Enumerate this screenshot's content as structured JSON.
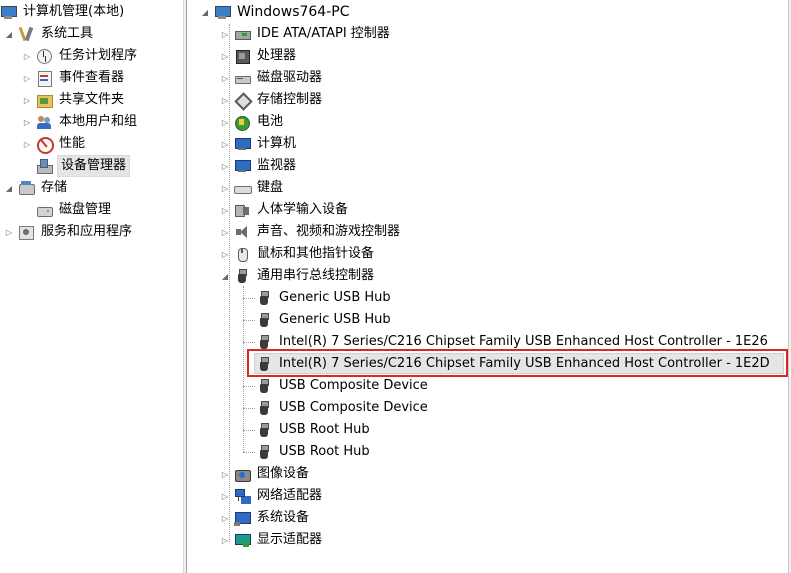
{
  "left_tree": {
    "root": "计算机管理(本地)",
    "system_tools": "系统工具",
    "task_scheduler": "任务计划程序",
    "event_viewer": "事件查看器",
    "shared_folders": "共享文件夹",
    "local_users": "本地用户和组",
    "performance": "性能",
    "device_manager": "设备管理器",
    "storage": "存储",
    "disk_management": "磁盘管理",
    "services": "服务和应用程序"
  },
  "right_tree": {
    "root": "Windows764-PC",
    "categories": [
      {
        "label": "IDE ATA/ATAPI 控制器",
        "icon": "ide-controller-icon"
      },
      {
        "label": "处理器",
        "icon": "processor-icon"
      },
      {
        "label": "磁盘驱动器",
        "icon": "disk-drive-icon"
      },
      {
        "label": "存储控制器",
        "icon": "storage-controller-icon"
      },
      {
        "label": "电池",
        "icon": "battery-icon"
      },
      {
        "label": "计算机",
        "icon": "computer-icon"
      },
      {
        "label": "监视器",
        "icon": "monitor-icon"
      },
      {
        "label": "键盘",
        "icon": "keyboard-icon"
      },
      {
        "label": "人体学输入设备",
        "icon": "hid-icon"
      },
      {
        "label": "声音、视频和游戏控制器",
        "icon": "sound-icon"
      },
      {
        "label": "鼠标和其他指针设备",
        "icon": "mouse-icon"
      },
      {
        "label": "通用串行总线控制器",
        "icon": "usb-icon"
      }
    ],
    "usb_children": [
      "Generic USB Hub",
      "Generic USB Hub",
      "Intel(R) 7 Series/C216 Chipset Family USB Enhanced Host Controller - 1E26",
      "Intel(R) 7 Series/C216 Chipset Family USB Enhanced Host Controller - 1E2D",
      "USB Composite Device",
      "USB Composite Device",
      "USB Root Hub",
      "USB Root Hub"
    ],
    "after_usb": [
      {
        "label": "图像设备",
        "icon": "imaging-icon"
      },
      {
        "label": "网络适配器",
        "icon": "network-adapter-icon"
      },
      {
        "label": "系统设备",
        "icon": "system-device-icon"
      },
      {
        "label": "显示适配器",
        "icon": "display-adapter-icon"
      }
    ]
  },
  "colors": {
    "highlight_border": "#e0242a",
    "selection_bg": "#e5e5e5"
  }
}
